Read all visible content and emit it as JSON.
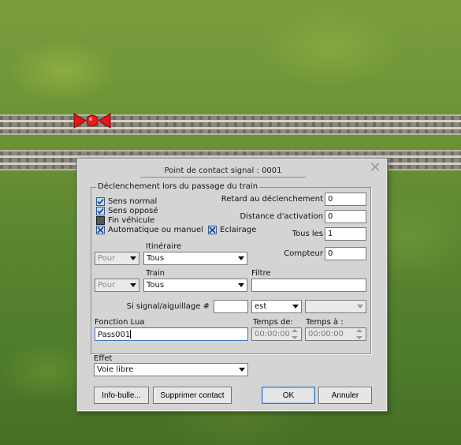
{
  "dialog": {
    "title": "Point de contact signal : 0001",
    "close_glyph": "✕",
    "trigger_group": {
      "legend": "Déclenchement lors du passage du train",
      "sens_normal": {
        "label": "Sens normal",
        "checked": true
      },
      "sens_oppose": {
        "label": "Sens opposé",
        "checked": true
      },
      "fin_vehicule": {
        "label": "Fin véhicule",
        "checked": false
      },
      "auto_manuel": {
        "label": "Automatique ou manuel",
        "checked": true
      },
      "eclairage": {
        "label": "Eclairage",
        "checked": true
      },
      "retard_label": "Retard au déclenchement",
      "retard_value": "0",
      "distance_label": "Distance d'activation",
      "distance_value": "0",
      "tous_les_label": "Tous les",
      "tous_les_value": "1",
      "compteur_label": "Compteur",
      "compteur_value": "0",
      "itineraire_label": "Itinéraire",
      "itineraire_mode": "Pour",
      "itineraire_value": "Tous",
      "train_label": "Train",
      "train_mode": "Pour",
      "train_value": "Tous",
      "filtre_label": "Filtre",
      "filtre_value": "",
      "signal_label": "Si signal/aiguillage #",
      "signal_value": "",
      "signal_op": "est",
      "signal_state": "",
      "lua_label": "Fonction Lua",
      "lua_value": "Pass001",
      "temps_de_label": "Temps de:",
      "temps_de_value": "00:00:00",
      "temps_a_label": "Temps à :",
      "temps_a_value": "00:00:00"
    },
    "effet_label": "Effet",
    "effet_value": "Voie libre",
    "buttons": {
      "info": "Info-bulle...",
      "delete": "Supprimer contact",
      "ok": "OK",
      "cancel": "Annuler"
    }
  }
}
